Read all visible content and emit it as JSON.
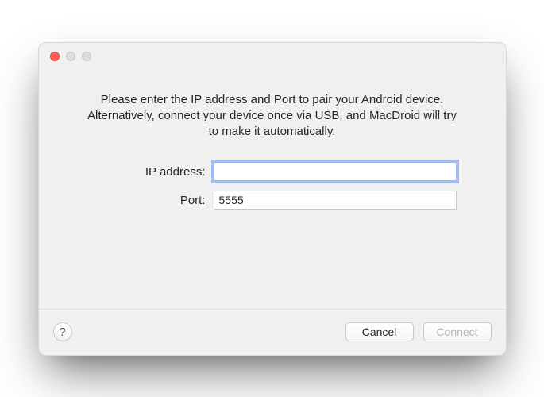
{
  "traffic_lights": {
    "close_color": "#ff5f57",
    "minimize_color": "#dcdcdc",
    "maximize_color": "#dcdcdc"
  },
  "instruction": "Please enter the IP address and Port to pair your Android device. Alternatively, connect your device once via USB, and MacDroid will try to make it automatically.",
  "form": {
    "ip_label": "IP address:",
    "ip_value": "",
    "port_label": "Port:",
    "port_value": "5555"
  },
  "footer": {
    "help_label": "?",
    "cancel_label": "Cancel",
    "connect_label": "Connect",
    "connect_enabled": false
  }
}
